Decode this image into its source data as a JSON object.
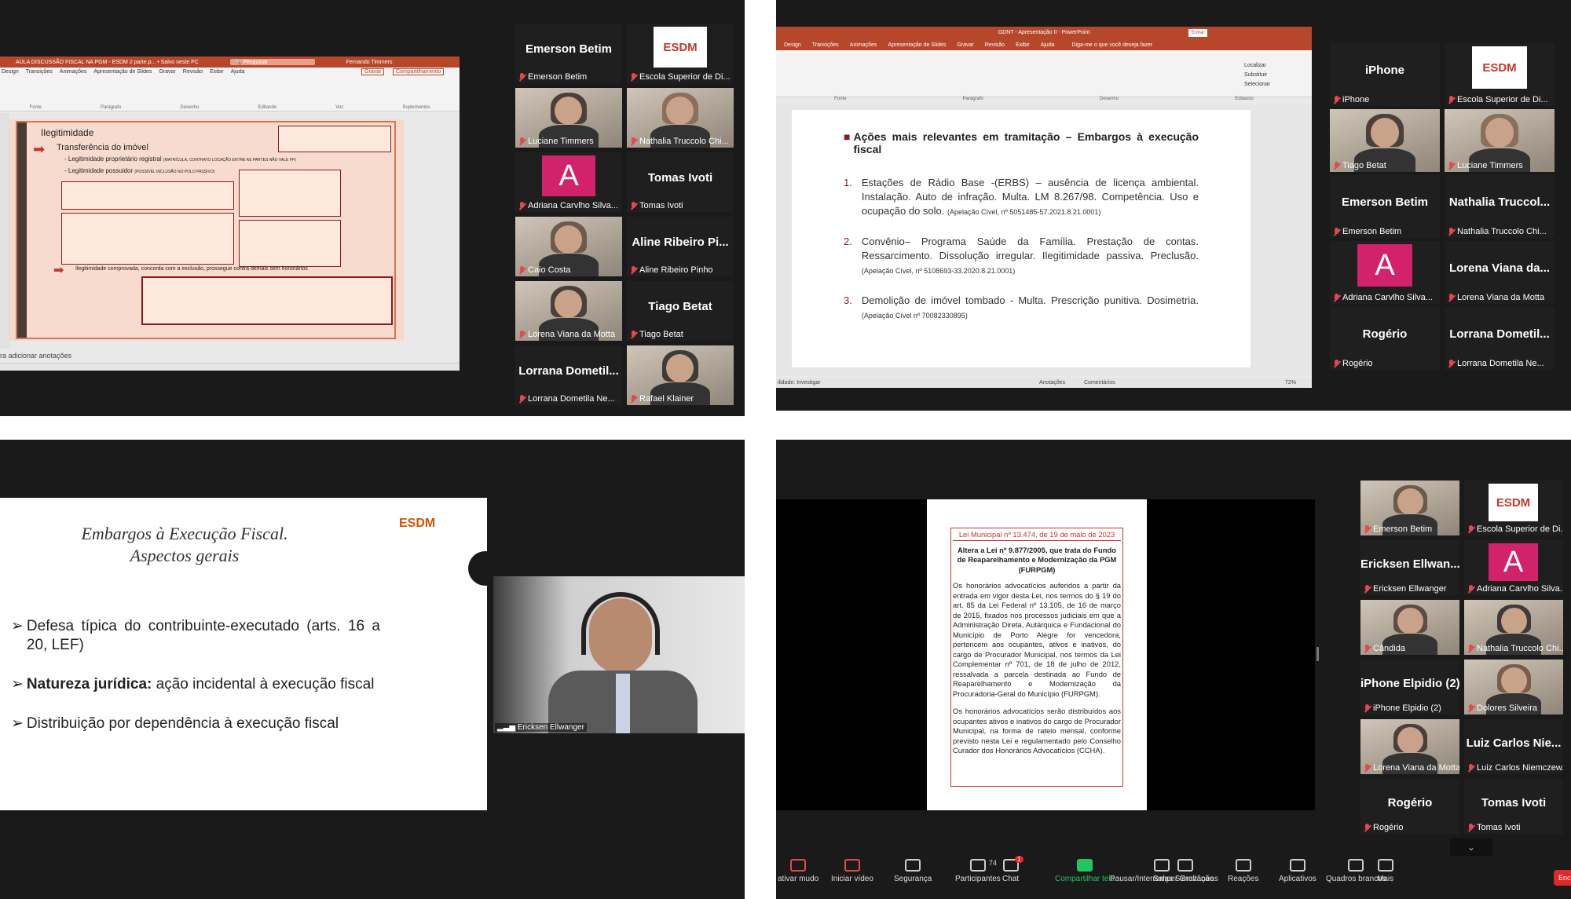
{
  "q1": {
    "pp_title": "AULA DISCUSSÃO FISCAL NA PGM - ESDM 2 parte.p... • Salvo neste PC",
    "pp_search": "Pesquisar",
    "pp_user": "Fernando Timmers",
    "pp_record": "Gravar",
    "pp_share": "Compartilhamento",
    "pp_tabs": [
      "Design",
      "Transições",
      "Animações",
      "Apresentação de Slides",
      "Gravar",
      "Revisão",
      "Exibir",
      "Ajuda"
    ],
    "ribbon_groups": [
      "Fonte",
      "Parágrafo",
      "Desenho",
      "Editando",
      "Voz",
      "Suplementos"
    ],
    "slide_heading": "Ilegitimidade",
    "slide_sub": "Transferência do imóvel",
    "slide_b1": "- Legitimidade proprietário registral",
    "slide_b1_small": "(MATRÍCULA, CONTRATO LOCAÇÃO ENTRE AS PARTES NÃO VALE FP)",
    "slide_b2": "- Legitimidade possuidor",
    "slide_b2_small": "(POSSÍVEL INCLUSÃO NO POLO PASSIVO)",
    "slide_b3": "Ilegitimidade comprovada, concorda com a exclusão, prossegue contra demais sem honorários",
    "notes": "ra adicionar anotações",
    "tiles": [
      {
        "name": "Emerson Betim",
        "big": "Emerson Betim",
        "type": "text"
      },
      {
        "name": "Escola Superior de Di...",
        "type": "logo",
        "logo": "ESDM"
      },
      {
        "name": "Luciane Timmers",
        "type": "video",
        "hl": true
      },
      {
        "name": "Nathalia Truccolo Chi...",
        "type": "video"
      },
      {
        "name": "Adriana Carvlho Silva...",
        "type": "avatar",
        "letter": "A"
      },
      {
        "name": "Tomas Ivoti",
        "big": "Tomas Ivoti",
        "type": "text"
      },
      {
        "name": "Caio Costa",
        "type": "video"
      },
      {
        "name": "Aline Ribeiro Pinho",
        "big": "Aline Ribeiro Pi...",
        "type": "text"
      },
      {
        "name": "Lorena Viana da Motta",
        "type": "video"
      },
      {
        "name": "Tiago Betat",
        "big": "Tiago Betat",
        "type": "text"
      },
      {
        "name": "Lorrana Dometila Ne...",
        "big": "Lorrana Dometil...",
        "type": "text"
      },
      {
        "name": "Rafael Klainer",
        "type": "video"
      }
    ]
  },
  "q2": {
    "pp_title": "GDNT - Apresentação II - PowerPoint",
    "pp_btn": "Entrar",
    "pp_tabs": [
      "Design",
      "Transições",
      "Animações",
      "Apresentação de Slides",
      "Gravar",
      "Revisão",
      "Exibir",
      "Ajuda"
    ],
    "pp_tell": "Diga-me o que você deseja fazer",
    "ribbon_groups": [
      "Fonte",
      "Parágrafo",
      "Desenho",
      "Editando"
    ],
    "editing": [
      "Localizar",
      "Substituir",
      "Selecionar"
    ],
    "slide_title": "Ações mais relevantes em tramitação – Embargos à execução fiscal",
    "items": [
      {
        "n": "1.",
        "text": "Estações de Rádio Base -(ERBS) – ausência de licença ambiental. Instalação. Auto de infração. Multa. LM 8.267/98. Competência. Uso e ocupação do solo.",
        "ref": "(Apelação Cível, nº 5051485-57.2021.8.21.0001)"
      },
      {
        "n": "2.",
        "text": "Convênio– Programa Saúde da Família. Prestação de contas. Ressarcimento. Dissolução irregular. Ilegitimidade passiva. Preclusão.",
        "ref": "(Apelação Cível, nº 5108693-33.2020.8.21.0001)"
      },
      {
        "n": "3.",
        "text": "Demolição de imóvel tombado - Multa. Prescrição punitiva. Dosimetria.",
        "ref": "(Apelação Cível nº 70082330895)"
      }
    ],
    "status_left": "ilidade: Investigar",
    "status_notes": "Anotações",
    "status_comments": "Comentários",
    "zoom": "72%",
    "tiles": [
      {
        "name": "iPhone",
        "big": "iPhone",
        "type": "text"
      },
      {
        "name": "Escola Superior de Di...",
        "type": "logo",
        "logo": "ESDM"
      },
      {
        "name": "Tiago Betat",
        "type": "video",
        "hl": true
      },
      {
        "name": "Luciane Timmers",
        "type": "video"
      },
      {
        "name": "Emerson Betim",
        "big": "Emerson Betim",
        "type": "text"
      },
      {
        "name": "Nathalia Truccolo Chi...",
        "big": "Nathalia Truccol...",
        "type": "text"
      },
      {
        "name": "Adriana Carvlho Silva...",
        "type": "avatar",
        "letter": "A"
      },
      {
        "name": "Lorena Viana da Motta",
        "big": "Lorena Viana da...",
        "type": "text"
      },
      {
        "name": "Rogério",
        "big": "Rogério",
        "type": "text"
      },
      {
        "name": "Lorrana Dometila Ne...",
        "big": "Lorrana Dometil...",
        "type": "text"
      }
    ]
  },
  "q3": {
    "title1": "Embargos à Execução Fiscal.",
    "title2": "Aspectos gerais",
    "logo": "ESDM",
    "b1": "Defesa típica do contribuinte-executado (arts. 16 a 20, LEF)",
    "b2_bold": "Natureza jurídica:",
    "b2_rest": " ação incidental à execução fiscal",
    "b3": "Distribuição por dependência à execução fiscal",
    "speaker": "Ericksen Ellwanger"
  },
  "q4": {
    "doc_title": "Lei Municipal nº 13.474, de 19 de maio de 2023",
    "doc_sub": "Altera a Lei nº 9.877/2005, que trata do Fundo de Reaparelhamento e Modernização da PGM (FURPGM)",
    "doc_p1": "Os honorários advocatícios auferidos a partir da entrada em vigor desta Lei, nos termos do § 19 do art. 85 da Lei Federal nº 13.105, de 16 de março de 2015, fixados nos processos judiciais em que a Administração Direta, Autárquica e Fundacional do Município de Porto Alegre for vencedora, pertencem aos ocupantes, ativos e inativos, do cargo de Procurador Municipal, nos termos da Lei Complementar nº 701, de 18 de julho de 2012, ressalvada a parcela destinada ao Fundo de Reaparelhamento e Modernização da Procuradoria-Geral do Município (FURPGM).",
    "doc_p2": "Os honorários advocatícios serão distribuídos aos ocupantes ativos e inativos do cargo de Procurador Municipal, na forma de rateio mensal, conforme previsto nesta Lei e regulamentado pelo Conselho Curador dos Honorários Advocatícios (CCHA).",
    "tiles": [
      {
        "name": "Emerson Betim",
        "type": "video"
      },
      {
        "name": "Escola Superior de Di...",
        "type": "logo",
        "logo": "ESDM"
      },
      {
        "name": "Ericksen Ellwanger",
        "big": "Ericksen Ellwan...",
        "type": "text"
      },
      {
        "name": "Adriana Carvlho Silva...",
        "type": "avatar",
        "letter": "A"
      },
      {
        "name": "Cândida",
        "type": "video",
        "hl": true
      },
      {
        "name": "Nathalia Truccolo Chi...",
        "type": "video"
      },
      {
        "name": "iPhone Elpidio (2)",
        "big": "iPhone Elpidio (2)",
        "type": "text"
      },
      {
        "name": "Dolores Silveira",
        "type": "video"
      },
      {
        "name": "Lorena Viana da Motta",
        "type": "video"
      },
      {
        "name": "Luiz Carlos Niemczew...",
        "big": "Luiz Carlos Nie...",
        "type": "text"
      },
      {
        "name": "Rogério",
        "big": "Rogério",
        "type": "text"
      },
      {
        "name": "Tomas Ivoti",
        "big": "Tomas Ivoti",
        "type": "text"
      }
    ],
    "toolbar": [
      {
        "label": "ativar mudo",
        "icon": "mic-off-icon"
      },
      {
        "label": "Iniciar vídeo",
        "icon": "video-off-icon"
      },
      {
        "label": "Segurança",
        "icon": "shield-icon"
      },
      {
        "label": "Participantes",
        "icon": "participants-icon",
        "count": "74"
      },
      {
        "label": "Chat",
        "icon": "chat-icon",
        "badge": "1"
      },
      {
        "label": "Compartilhar tela",
        "icon": "share-screen-icon"
      },
      {
        "label": "Pausar/Interromper Gravação",
        "icon": "pause-record-icon"
      },
      {
        "label": "Salas Simultâneas",
        "icon": "breakout-icon"
      },
      {
        "label": "Reações",
        "icon": "reactions-icon"
      },
      {
        "label": "Aplicativos",
        "icon": "apps-icon"
      },
      {
        "label": "Quadros brancos",
        "icon": "whiteboard-icon"
      },
      {
        "label": "Mais",
        "icon": "more-icon"
      }
    ],
    "end": "Enc"
  }
}
